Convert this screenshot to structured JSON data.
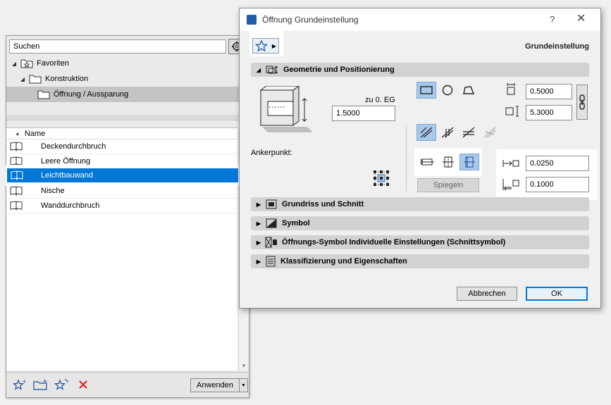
{
  "library": {
    "search_placeholder": "Suchen",
    "tree": [
      {
        "label": "Favoriten",
        "level": 0,
        "expanded": true
      },
      {
        "label": "Konstruktion",
        "level": 1,
        "expanded": true
      },
      {
        "label": "Öffnung / Aussparung",
        "level": 2,
        "selected": true
      }
    ],
    "list_header": "Name",
    "items": [
      {
        "label": "Deckendurchbruch"
      },
      {
        "label": "Leere Öffnung"
      },
      {
        "label": "Leichtbauwand",
        "selected": true
      },
      {
        "label": "Nische"
      },
      {
        "label": "Wanddurchbruch"
      }
    ],
    "apply_label": "Anwenden"
  },
  "dialog": {
    "title": "Öffnung Grundeinstellung",
    "help_label": "?",
    "close_label": "✕",
    "preset_name": "Grundeinstellung",
    "sections": [
      {
        "label": "Geometrie und Positionierung",
        "expanded": true
      },
      {
        "label": "Grundriss und Schnitt",
        "expanded": false
      },
      {
        "label": "Symbol",
        "expanded": false
      },
      {
        "label": "Öffnungs-Symbol Individuelle Einstellungen (Schnittsymbol)",
        "expanded": false
      },
      {
        "label": "Klassifizierung und Eigenschaften",
        "expanded": false
      }
    ],
    "geometry": {
      "ref_label": "zu 0. EG",
      "ref_value": "1.5000",
      "width_value": "0.5000",
      "height_value": "5.3000",
      "anchor_label": "Ankerpunkt:",
      "offset1_value": "0.0250",
      "offset2_value": "0.1000",
      "mirror_label": "Spiegeln"
    },
    "cancel_label": "Abbrechen",
    "ok_label": "OK"
  },
  "colors": {
    "selection": "#0078d7",
    "toggle_active": "#aac8ea",
    "delete_red": "#e02020"
  }
}
